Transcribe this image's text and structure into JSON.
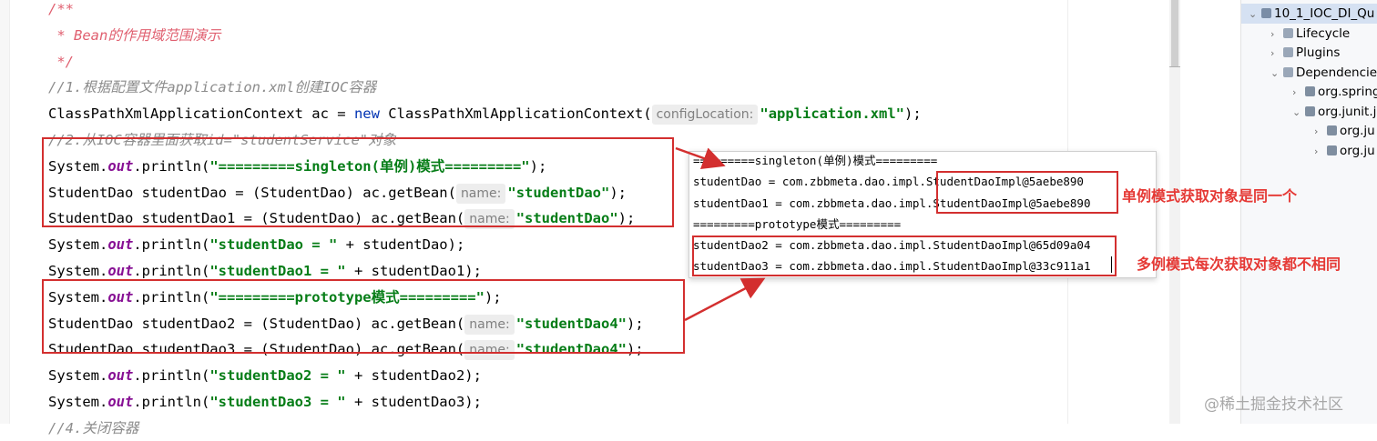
{
  "editor": {
    "lines": [
      {
        "parts": [
          {
            "t": "/**",
            "c": "cmhead"
          }
        ]
      },
      {
        "parts": [
          {
            "t": " * Bean的作用域范围演示",
            "c": "cmhead"
          }
        ]
      },
      {
        "parts": [
          {
            "t": " */",
            "c": "cmhead"
          }
        ]
      },
      {
        "parts": [
          {
            "t": "//1.根据配置文件application.xml创建IOC容器",
            "c": "cm"
          }
        ]
      },
      {
        "parts": [
          {
            "t": "ClassPathXmlApplicationContext ac = ",
            "c": ""
          },
          {
            "t": "new",
            "c": "kw"
          },
          {
            "t": " ClassPathXmlApplicationContext(",
            "c": ""
          },
          {
            "t": "configLocation:",
            "c": "hint"
          },
          {
            "t": "\"application.xml\"",
            "c": "str"
          },
          {
            "t": ");",
            "c": ""
          }
        ]
      },
      {
        "parts": [
          {
            "t": "//2.从IOC容器里面获取id=\"studentService\"对象",
            "c": "cm"
          }
        ]
      },
      {
        "parts": [
          {
            "t": "System.",
            "c": ""
          },
          {
            "t": "out",
            "c": "fld"
          },
          {
            "t": ".println(",
            "c": ""
          },
          {
            "t": "\"=========singleton(单例)模式=========\"",
            "c": "str"
          },
          {
            "t": ");",
            "c": ""
          }
        ]
      },
      {
        "parts": [
          {
            "t": "StudentDao studentDao = (StudentDao) ac.getBean(",
            "c": ""
          },
          {
            "t": "name:",
            "c": "hint"
          },
          {
            "t": "\"studentDao\"",
            "c": "str"
          },
          {
            "t": ");",
            "c": ""
          }
        ]
      },
      {
        "parts": [
          {
            "t": "StudentDao studentDao1 = (StudentDao) ac.getBean(",
            "c": ""
          },
          {
            "t": "name:",
            "c": "hint"
          },
          {
            "t": "\"studentDao\"",
            "c": "str"
          },
          {
            "t": ");",
            "c": ""
          }
        ]
      },
      {
        "parts": [
          {
            "t": "System.",
            "c": ""
          },
          {
            "t": "out",
            "c": "fld"
          },
          {
            "t": ".println(",
            "c": ""
          },
          {
            "t": "\"studentDao = \"",
            "c": "str"
          },
          {
            "t": " + studentDao);",
            "c": ""
          }
        ]
      },
      {
        "parts": [
          {
            "t": "System.",
            "c": ""
          },
          {
            "t": "out",
            "c": "fld"
          },
          {
            "t": ".println(",
            "c": ""
          },
          {
            "t": "\"studentDao1 = \"",
            "c": "str"
          },
          {
            "t": " + studentDao1);",
            "c": ""
          }
        ]
      },
      {
        "parts": [
          {
            "t": "System.",
            "c": ""
          },
          {
            "t": "out",
            "c": "fld"
          },
          {
            "t": ".println(",
            "c": ""
          },
          {
            "t": "\"=========prototype模式=========\"",
            "c": "str"
          },
          {
            "t": ");",
            "c": ""
          }
        ]
      },
      {
        "parts": [
          {
            "t": "StudentDao studentDao2 = (StudentDao) ac.getBean(",
            "c": ""
          },
          {
            "t": "name:",
            "c": "hint"
          },
          {
            "t": "\"studentDao4\"",
            "c": "str"
          },
          {
            "t": ");",
            "c": ""
          }
        ]
      },
      {
        "parts": [
          {
            "t": "StudentDao studentDao3 = (StudentDao) ac.getBean(",
            "c": ""
          },
          {
            "t": "name:",
            "c": "hint"
          },
          {
            "t": "\"studentDao4\"",
            "c": "str"
          },
          {
            "t": ");",
            "c": ""
          }
        ]
      },
      {
        "parts": [
          {
            "t": "System.",
            "c": ""
          },
          {
            "t": "out",
            "c": "fld"
          },
          {
            "t": ".println(",
            "c": ""
          },
          {
            "t": "\"studentDao2 = \"",
            "c": "str"
          },
          {
            "t": " + studentDao2);",
            "c": ""
          }
        ]
      },
      {
        "parts": [
          {
            "t": "System.",
            "c": ""
          },
          {
            "t": "out",
            "c": "fld"
          },
          {
            "t": ".println(",
            "c": ""
          },
          {
            "t": "\"studentDao3 = \"",
            "c": "str"
          },
          {
            "t": " + studentDao3);",
            "c": ""
          }
        ]
      },
      {
        "parts": [
          {
            "t": "//4.关闭容器",
            "c": "cm"
          }
        ]
      }
    ]
  },
  "console": {
    "lines": [
      "=========singleton(单例)模式=========",
      "studentDao = com.zbbmeta.dao.impl.StudentDaoImpl@5aebe890",
      "studentDao1 = com.zbbmeta.dao.impl.StudentDaoImpl@5aebe890",
      "=========prototype模式=========",
      "studentDao2 = com.zbbmeta.dao.impl.StudentDaoImpl@65d09a04",
      "studentDao3 = com.zbbmeta.dao.impl.StudentDaoImpl@33c911a1"
    ]
  },
  "annotations": {
    "singleton_note": "单例模式获取对象是同一个",
    "prototype_note": "多例模式每次获取对象都不相同"
  },
  "project_tree": {
    "items": [
      {
        "label": "10_1_IOC_DI_Qu",
        "arrow": "down",
        "icon": "module-icon"
      },
      {
        "label": "Lifecycle",
        "arrow": "right",
        "icon": "maven-folder-icon"
      },
      {
        "label": "Plugins",
        "arrow": "right",
        "icon": "maven-folder-icon"
      },
      {
        "label": "Dependencie",
        "arrow": "down",
        "icon": "library-folder-icon"
      },
      {
        "label": "org.spring",
        "arrow": "right",
        "icon": "library-icon"
      },
      {
        "label": "org.junit.j",
        "arrow": "down",
        "icon": "library-icon"
      },
      {
        "label": "org.ju",
        "arrow": "right",
        "icon": "library-icon"
      },
      {
        "label": "org.ju",
        "arrow": "right",
        "icon": "library-icon"
      }
    ]
  },
  "watermark": "@稀土掘金技术社区",
  "colors": {
    "annotation_red": "#d32f2f",
    "string_green": "#067d17",
    "keyword_blue": "#0033b3",
    "field_purple": "#871094"
  }
}
